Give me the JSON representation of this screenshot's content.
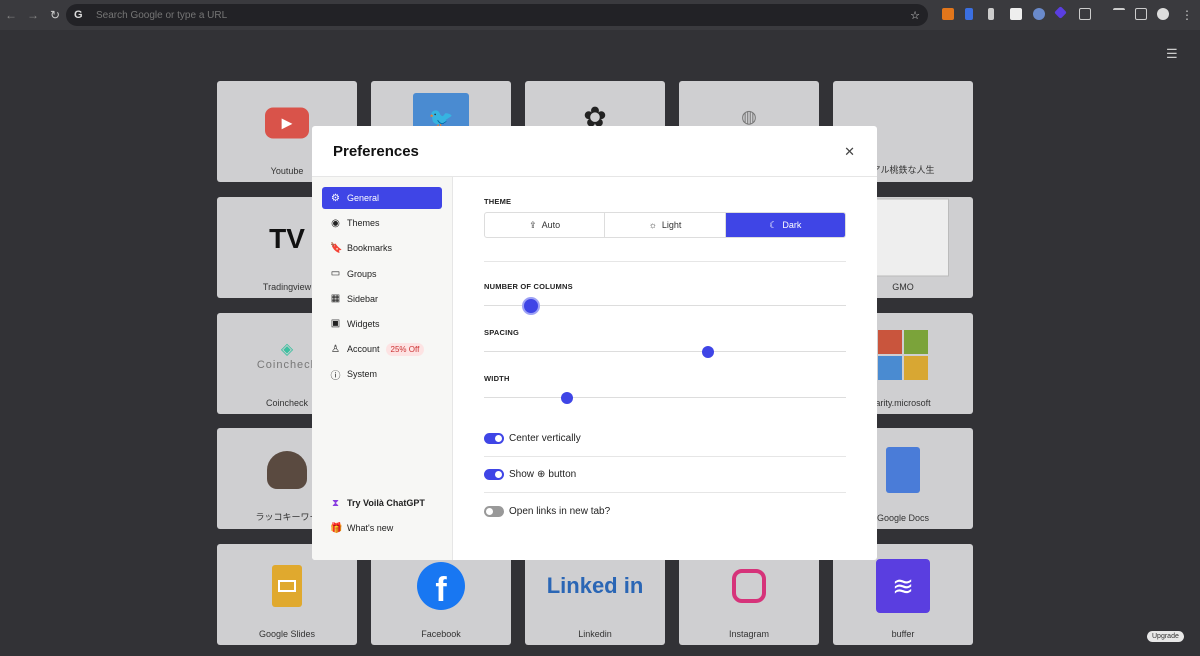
{
  "browser": {
    "address_placeholder": "Search Google or type a URL"
  },
  "tiles": [
    {
      "label": "Youtube",
      "icon": "youtube-icon",
      "color": "#d9534a"
    },
    {
      "label": "",
      "icon": "twitter-icon",
      "color": "#4a8bd1"
    },
    {
      "label": "",
      "icon": "openai-icon",
      "color": "#222"
    },
    {
      "label": "",
      "icon": "globe-icon",
      "color": "#777"
    },
    {
      "label": "アル桃鉄な人生",
      "icon": "",
      "color": ""
    },
    {
      "label": "Tradingview",
      "icon": "tradingview-icon",
      "color": "#111"
    },
    {
      "label": "",
      "icon": "",
      "color": ""
    },
    {
      "label": "",
      "icon": "",
      "color": ""
    },
    {
      "label": "",
      "icon": "",
      "color": ""
    },
    {
      "label": "GMO",
      "icon": "gmo-screenshot",
      "color": "#eee"
    },
    {
      "label": "Coincheck",
      "icon": "coincheck-icon",
      "color": "#3cc0a0",
      "logo_text": "Coincheck"
    },
    {
      "label": "",
      "icon": "",
      "color": ""
    },
    {
      "label": "",
      "icon": "",
      "color": ""
    },
    {
      "label": "",
      "icon": "",
      "color": ""
    },
    {
      "label": "arity.microsoft",
      "icon": "microsoft-icon",
      "color": ""
    },
    {
      "label": "ラッコキーワー",
      "icon": "otter-icon",
      "color": "#5a4a40"
    },
    {
      "label": "",
      "icon": "",
      "color": ""
    },
    {
      "label": "",
      "icon": "",
      "color": ""
    },
    {
      "label": "",
      "icon": "",
      "color": ""
    },
    {
      "label": "Google Docs",
      "icon": "google-docs-icon",
      "color": "#4a7cd8"
    },
    {
      "label": "Google Slides",
      "icon": "google-slides-icon",
      "color": "#e0a92e"
    },
    {
      "label": "Facebook",
      "icon": "facebook-icon",
      "color": "#1877f2"
    },
    {
      "label": "Linkedin",
      "icon": "linkedin-icon",
      "color": "#2a66b5",
      "logo_text": "Linked in"
    },
    {
      "label": "Instagram",
      "icon": "instagram-icon",
      "color": "#d6337a"
    },
    {
      "label": "buffer",
      "icon": "buffer-icon",
      "color": "#5a3ee0"
    }
  ],
  "modal": {
    "title": "Preferences",
    "sidebar": [
      {
        "label": "General",
        "icon": "gear-icon",
        "active": true
      },
      {
        "label": "Themes",
        "icon": "eye-icon"
      },
      {
        "label": "Bookmarks",
        "icon": "bookmark-icon"
      },
      {
        "label": "Groups",
        "icon": "folder-icon"
      },
      {
        "label": "Sidebar",
        "icon": "layout-icon"
      },
      {
        "label": "Widgets",
        "icon": "widgets-icon"
      },
      {
        "label": "Account",
        "icon": "user-icon",
        "badge": "25% Off"
      },
      {
        "label": "System",
        "icon": "info-icon"
      }
    ],
    "sidebar_bottom": [
      {
        "label": "Try Voilà ChatGPT",
        "icon": "voila-icon"
      },
      {
        "label": "What's new",
        "icon": "gift-icon"
      }
    ],
    "theme": {
      "label": "THEME",
      "options": [
        "Auto",
        "Light",
        "Dark"
      ],
      "selected": "Dark"
    },
    "columns": {
      "label": "NUMBER OF COLUMNS",
      "value": 0.13
    },
    "spacing": {
      "label": "SPACING",
      "value": 0.62
    },
    "width": {
      "label": "WIDTH",
      "value": 0.23
    },
    "toggles": [
      {
        "label_before": "Center vertically",
        "label_after": "",
        "on": true
      },
      {
        "label_before": "Show",
        "label_after": "button",
        "on": true,
        "icon": "plus-circle-icon"
      },
      {
        "label_before": "Open links in new tab?",
        "label_after": "",
        "on": false
      }
    ]
  },
  "upgrade": "Upgrade",
  "accent": "#3f45e6"
}
